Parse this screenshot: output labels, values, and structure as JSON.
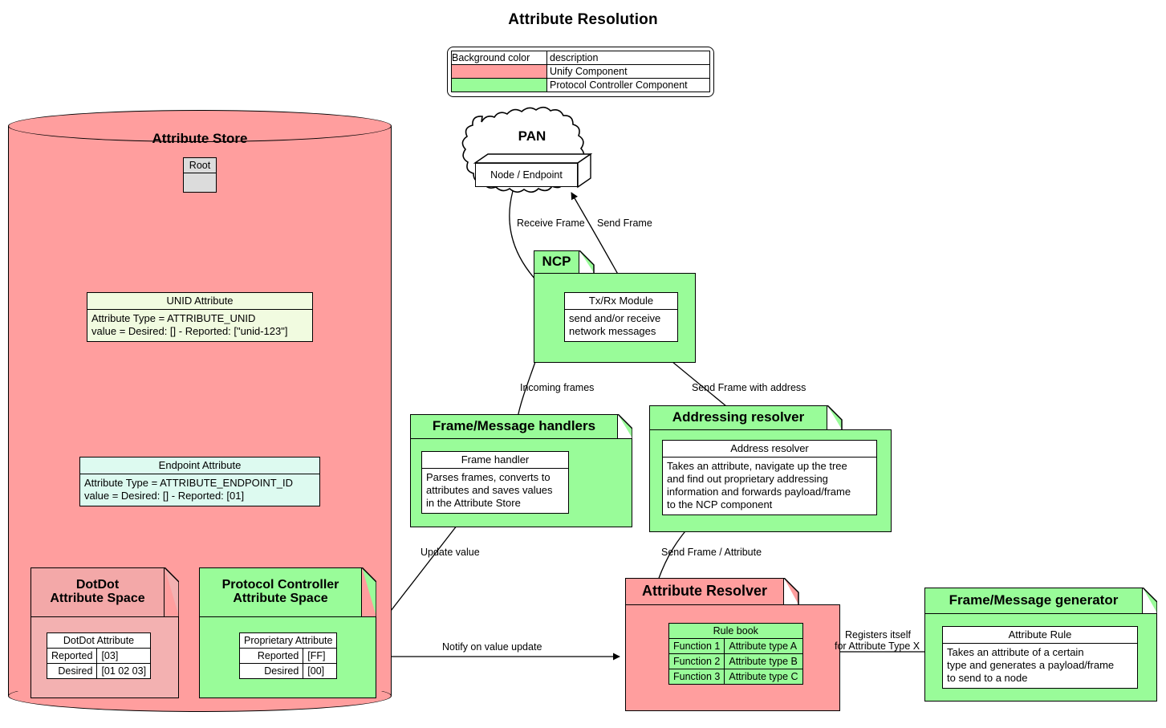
{
  "title": "Attribute Resolution",
  "colors": {
    "unify_component": "#ff9e9e",
    "protocol_controller_component": "#99fc99",
    "unid_attribute_bg": "#f1fbe0",
    "endpoint_attribute_bg": "#ddfaf0",
    "root_node_bg": "#dcdcdc",
    "stroke": "#000000",
    "page_bg": "#ffffff"
  },
  "legend": {
    "headers": [
      "Background color",
      "description"
    ],
    "rows": [
      {
        "swatch": "#ff9e9e",
        "description": "Unify Component"
      },
      {
        "swatch": "#99fc99",
        "description": "Protocol Controller Component"
      }
    ]
  },
  "attribute_store": {
    "label": "Attribute Store",
    "root": {
      "title": "Root"
    },
    "unid_attribute": {
      "title": "UNID Attribute",
      "lines": [
        "Attribute Type = ATTRIBUTE_UNID",
        "value = Desired: [] - Reported: [\"unid-123\"]"
      ]
    },
    "endpoint_attribute": {
      "title": "Endpoint Attribute",
      "lines": [
        "Attribute Type = ATTRIBUTE_ENDPOINT_ID",
        "value = Desired: [] - Reported: [01]"
      ]
    },
    "dotdot_space": {
      "title_line1": "DotDot",
      "title_line2": "Attribute Space",
      "attribute": {
        "header": "DotDot Attribute",
        "rows": [
          {
            "key": "Reported",
            "value": "[03]"
          },
          {
            "key": "Desired",
            "value": "[01 02 03]"
          }
        ]
      }
    },
    "pc_space": {
      "title_line1": "Protocol Controller",
      "title_line2": "Attribute Space",
      "attribute": {
        "header": "Proprietary Attribute",
        "rows": [
          {
            "key": "Reported",
            "value": "[FF]"
          },
          {
            "key": "Desired",
            "value": "[00]"
          }
        ]
      }
    }
  },
  "pan": {
    "label": "PAN",
    "node": {
      "label": "Node / Endpoint"
    }
  },
  "ncp": {
    "title": "NCP",
    "module": {
      "title": "Tx/Rx Module",
      "lines": [
        "send and/or receive",
        "network messages"
      ]
    }
  },
  "frame_message_handlers": {
    "title": "Frame/Message handlers",
    "handler": {
      "title": "Frame handler",
      "lines": [
        "Parses frames, converts to",
        "attributes and saves values",
        "in the Attribute Store"
      ]
    }
  },
  "addressing_resolver": {
    "title": "Addressing resolver",
    "resolver": {
      "title": "Address resolver",
      "lines": [
        "Takes an attribute, navigate up the tree",
        "and find out proprietary addressing",
        "information and forwards payload/frame",
        "to the NCP component"
      ]
    }
  },
  "attribute_resolver": {
    "title": "Attribute Resolver",
    "rule_book": {
      "header": "Rule book",
      "rows": [
        {
          "function": "Function 1",
          "attribute_type": "Attribute type A"
        },
        {
          "function": "Function 2",
          "attribute_type": "Attribute type B"
        },
        {
          "function": "Function 3",
          "attribute_type": "Attribute type C"
        }
      ]
    }
  },
  "frame_message_generator": {
    "title": "Frame/Message generator",
    "rule": {
      "title": "Attribute Rule",
      "lines": [
        "Takes an attribute of a certain",
        "type and generates a payload/frame",
        "to send to a node"
      ]
    }
  },
  "edges": {
    "receive_frame": "Receive Frame",
    "send_frame": "Send Frame",
    "incoming_frames": "Incoming frames",
    "send_frame_with_address": "Send Frame with address",
    "update_value": "Update value",
    "send_frame_attribute": "Send Frame / Attribute",
    "notify_on_value_update": "Notify on value update",
    "registers_itself_line1": "Registers itself",
    "registers_itself_line2": "for Attribute Type X"
  }
}
